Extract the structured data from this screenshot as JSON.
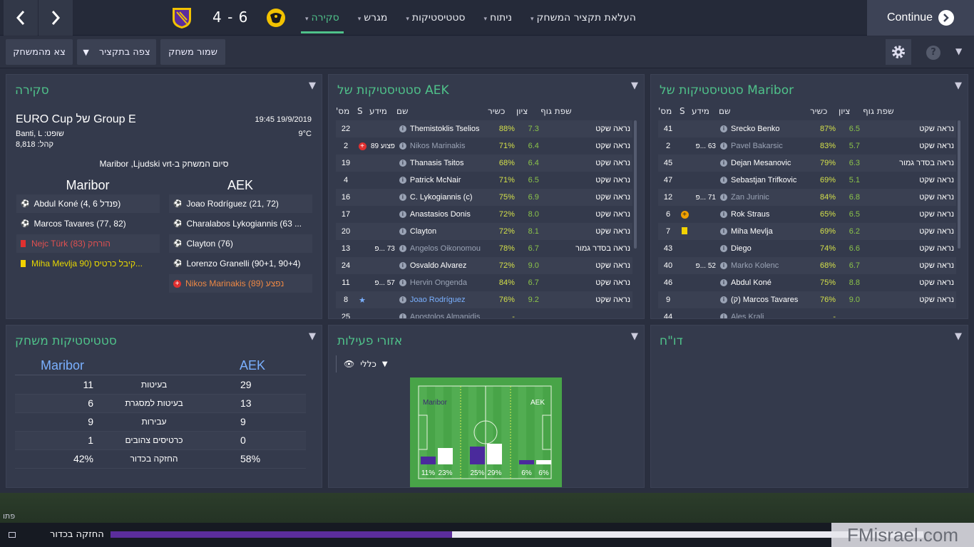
{
  "topbar": {
    "score": "4 - 6",
    "menu": [
      {
        "label": "סקירה",
        "active": true
      },
      {
        "label": "מגרש",
        "active": false
      },
      {
        "label": "סטטיסטיקות",
        "active": false
      },
      {
        "label": "ניתוח",
        "active": false
      },
      {
        "label": "העלאת תקציר המשחק",
        "active": false
      }
    ],
    "continue_label": "Continue",
    "colors": {
      "accent": "#4fc28a",
      "maribor": "#5b2d9c",
      "aek": "#f2c200"
    }
  },
  "toolbar": {
    "exit_label": "צא מהמשחק",
    "watch_label": "צפה בתקציר",
    "save_label": "שמור משחק"
  },
  "overview": {
    "title": "סקירה",
    "competition": "EURO Cup של Group E",
    "datetime": "19:45 19/9/2019",
    "referee": "Banti, L :שופט",
    "temperature": "9°C",
    "attendance": "קהל: 8,818",
    "result_text": "Maribor ,Ljudski vrt-סיום המשחק ב",
    "home_team": "Maribor",
    "away_team": "AEK",
    "home_events": [
      {
        "type": "goal",
        "text": "Abdul Koné (4, 6 פנדל)"
      },
      {
        "type": "goal",
        "text": "Marcos Tavares (77, 82)"
      },
      {
        "type": "red",
        "text": "Nejc Türk הורחק (83)"
      },
      {
        "type": "yellow",
        "text": "Miha Mevlja קיבל כרטיס (90..."
      }
    ],
    "away_events": [
      {
        "type": "goal",
        "text": "Joao Rodríguez (21, 72)"
      },
      {
        "type": "goal",
        "text": "Charalabos Lykogiannis (63 ..."
      },
      {
        "type": "goal",
        "text": "Clayton (76)"
      },
      {
        "type": "goal",
        "text": "Lorenzo Granelli (90+1, 90+4)"
      },
      {
        "type": "injury",
        "text": "Nikos Marinakis נפצע (89)"
      }
    ]
  },
  "aek_stats": {
    "title": "AEK סטטיסטיקות של",
    "headers": {
      "num": "מס'",
      "s": "S",
      "info": "מידע",
      "name": "שם",
      "fitness": "כשיר",
      "rating": "ציון",
      "body": "שפת גוף"
    },
    "rows": [
      {
        "num": "22",
        "info": "",
        "name": "Themistoklis Tselios",
        "fit": "88%",
        "rating": "7.3",
        "body": "נראה שקט",
        "dim": false
      },
      {
        "num": "2",
        "info": "פצוע 89",
        "name": "Nikos Marinakis",
        "fit": "71%",
        "rating": "6.4",
        "body": "נראה שקט",
        "dim": true,
        "icon": "injury"
      },
      {
        "num": "19",
        "info": "",
        "name": "Thanasis Tsitos",
        "fit": "68%",
        "rating": "6.4",
        "body": "נראה שקט",
        "dim": false
      },
      {
        "num": "4",
        "info": "",
        "name": "Patrick McNair",
        "fit": "71%",
        "rating": "6.5",
        "body": "נראה שקט",
        "dim": false
      },
      {
        "num": "16",
        "info": "",
        "name": "C. Lykogiannis (c)",
        "fit": "75%",
        "rating": "6.9",
        "body": "נראה שקט",
        "dim": false
      },
      {
        "num": "17",
        "info": "",
        "name": "Anastasios Donis",
        "fit": "72%",
        "rating": "8.0",
        "body": "נראה שקט",
        "dim": false
      },
      {
        "num": "20",
        "info": "",
        "name": "Clayton",
        "fit": "72%",
        "rating": "8.1",
        "body": "נראה שקט",
        "dim": false
      },
      {
        "num": "13",
        "info": "73 ...פ",
        "name": "Angelos Oikonomou",
        "fit": "78%",
        "rating": "6.7",
        "body": "נראה בסדר גמור",
        "dim": true
      },
      {
        "num": "24",
        "info": "",
        "name": "Osvaldo Alvarez",
        "fit": "72%",
        "rating": "9.0",
        "body": "נראה שקט",
        "dim": false
      },
      {
        "num": "11",
        "info": "57 ...פ",
        "name": "Hervin Ongenda",
        "fit": "84%",
        "rating": "6.7",
        "body": "נראה שקט",
        "dim": true
      },
      {
        "num": "8",
        "info": "",
        "name": "Joao Rodríguez",
        "fit": "76%",
        "rating": "9.2",
        "body": "נראה שקט",
        "dim": false,
        "icon": "star",
        "highlight": true
      },
      {
        "num": "25",
        "info": "",
        "name": "Apostolos Almanidis",
        "fit": "-",
        "rating": "",
        "body": "",
        "dim": true
      }
    ]
  },
  "maribor_stats": {
    "title": "Maribor סטטיסטיקות של",
    "rows": [
      {
        "num": "41",
        "info": "",
        "name": "Srecko Benko",
        "fit": "87%",
        "rating": "6.5",
        "body": "נראה שקט",
        "dim": false
      },
      {
        "num": "2",
        "info": "63 ...פ",
        "name": "Pavel Bakarsic",
        "fit": "83%",
        "rating": "5.7",
        "body": "נראה שקט",
        "dim": true
      },
      {
        "num": "45",
        "info": "",
        "name": "Dejan Mesanovic",
        "fit": "79%",
        "rating": "6.3",
        "body": "נראה בסדר גמור",
        "dim": false
      },
      {
        "num": "47",
        "info": "",
        "name": "Sebastjan Trifkovic",
        "fit": "69%",
        "rating": "5.1",
        "body": "נראה שקט",
        "dim": false
      },
      {
        "num": "12",
        "info": "71 ...פ",
        "name": "Zan Jurinic",
        "fit": "84%",
        "rating": "6.8",
        "body": "נראה שקט",
        "dim": true
      },
      {
        "num": "6",
        "info": "",
        "name": "Rok Straus",
        "fit": "65%",
        "rating": "6.5",
        "body": "נראה שקט",
        "dim": false,
        "icon": "sub"
      },
      {
        "num": "7",
        "info": "",
        "name": "Miha Mevlja",
        "fit": "69%",
        "rating": "6.2",
        "body": "נראה שקט",
        "dim": false,
        "icon": "yellow"
      },
      {
        "num": "43",
        "info": "",
        "name": "Diego",
        "fit": "74%",
        "rating": "6.6",
        "body": "נראה שקט",
        "dim": false
      },
      {
        "num": "40",
        "info": "52 ...פ",
        "name": "Marko Kolenc",
        "fit": "68%",
        "rating": "6.7",
        "body": "נראה שקט",
        "dim": true
      },
      {
        "num": "46",
        "info": "",
        "name": "Abdul Koné",
        "fit": "75%",
        "rating": "8.8",
        "body": "נראה שקט",
        "dim": false
      },
      {
        "num": "9",
        "info": "",
        "name": "(ק) Marcos Tavares",
        "fit": "76%",
        "rating": "9.0",
        "body": "נראה שקט",
        "dim": false
      },
      {
        "num": "44",
        "info": "",
        "name": "Ales Kralj",
        "fit": "-",
        "rating": "",
        "body": "",
        "dim": true
      }
    ]
  },
  "match_stats": {
    "title": "סטטיסטיקות משחק",
    "home": "Maribor",
    "away": "AEK",
    "rows": [
      {
        "label": "בעיטות",
        "home": "11",
        "away": "29"
      },
      {
        "label": "בעיטות למסגרת",
        "home": "6",
        "away": "13"
      },
      {
        "label": "עבירות",
        "home": "9",
        "away": "9"
      },
      {
        "label": "כרטיסים צהובים",
        "home": "1",
        "away": "0"
      },
      {
        "label": "החזקה בכדור",
        "home": "42%",
        "away": "58%"
      }
    ]
  },
  "activity": {
    "title": "אזורי פעילות",
    "filter": "כללי",
    "home_label": "Maribor",
    "away_label": "AEK",
    "zones": [
      {
        "home": 11,
        "away": 23
      },
      {
        "home": 25,
        "away": 29
      },
      {
        "home": 6,
        "away": 6
      }
    ],
    "zone_labels": [
      "11%",
      "23%",
      "25%",
      "29%",
      "6%",
      "6%"
    ]
  },
  "report": {
    "title": "דו\"ח"
  },
  "bottom": {
    "possession_label": "החזקה בכדור",
    "possession_home": 42,
    "watermark": "FMisrael.com",
    "edge_text": "פתו"
  }
}
